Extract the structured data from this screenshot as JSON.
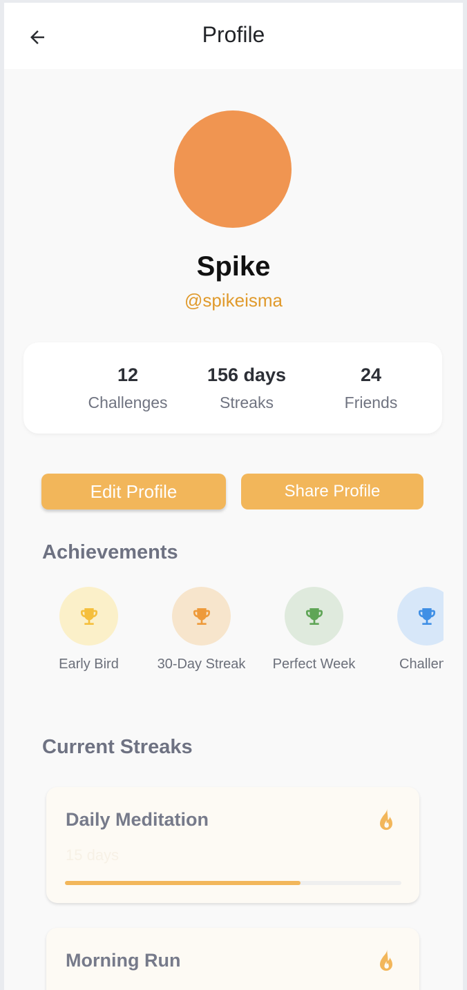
{
  "header": {
    "title": "Profile",
    "back_icon": "arrow-left-icon"
  },
  "profile": {
    "avatar_color": "#f09551",
    "name": "Spike",
    "handle": "@spikeisma"
  },
  "stats": [
    {
      "value": "12",
      "label": "Challenges"
    },
    {
      "value": "156 days",
      "label": "Streaks"
    },
    {
      "value": "24",
      "label": "Friends"
    }
  ],
  "actions": {
    "edit_label": "Edit Profile",
    "share_label": "Share Profile"
  },
  "achievements": {
    "title": "Achievements",
    "items": [
      {
        "label": "Early Bird",
        "icon": "trophy-icon",
        "color": "#f5bf3c",
        "bg": "#fbf0c9"
      },
      {
        "label": "30-Day Streak",
        "icon": "trophy-icon",
        "color": "#ee9a3a",
        "bg": "#f7e5cc"
      },
      {
        "label": "Perfect Week",
        "icon": "trophy-icon",
        "color": "#5fa556",
        "bg": "#dfeadd"
      },
      {
        "label": "Challeng",
        "icon": "trophy-icon",
        "color": "#3f8fe5",
        "bg": "#d7e7f9"
      }
    ]
  },
  "streaks": {
    "title": "Current Streaks",
    "items": [
      {
        "name": "Daily Meditation",
        "days": "15 days",
        "progress": 0.7,
        "icon": "flame-icon"
      },
      {
        "name": "Morning Run",
        "days": "",
        "progress": null,
        "icon": "flame-icon"
      }
    ]
  },
  "colors": {
    "accent": "#f2b65a",
    "handle": "#e09a2c",
    "flame": "#f2b65a"
  }
}
